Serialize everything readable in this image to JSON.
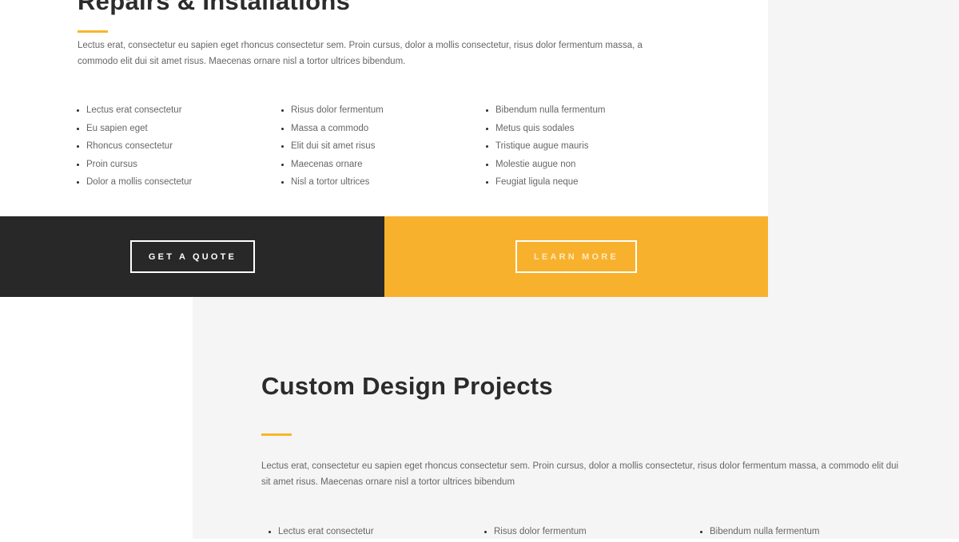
{
  "repairs": {
    "title": "Repairs & Installations",
    "paragraph": "Lectus erat, consectetur eu sapien eget rhoncus consectetur sem. Proin cursus, dolor a mollis consectetur, risus dolor fermentum massa, a commodo elit dui sit amet risus. Maecenas ornare nisl a tortor ultrices bibendum.",
    "list_columns": [
      [
        "Lectus erat consectetur",
        "Eu sapien eget",
        "Rhoncus consectetur",
        "Proin cursus",
        "Dolor a mollis consectetur"
      ],
      [
        "Risus dolor fermentum",
        "Massa a commodo",
        "Elit dui sit amet risus",
        "Maecenas ornare",
        "Nisl a tortor ultrices"
      ],
      [
        "Bibendum nulla fermentum",
        "Metus quis sodales",
        "Tristique augue mauris",
        "Molestie augue non",
        "Feugiat ligula neque"
      ]
    ]
  },
  "cta": {
    "quote_label": "GET A QUOTE",
    "learn_label": "LEARN MORE"
  },
  "custom": {
    "title": "Custom Design Projects",
    "paragraph": "Lectus erat, consectetur eu sapien eget rhoncus consectetur sem. Proin cursus, dolor a mollis consectetur, risus dolor fermentum massa, a commodo elit dui sit amet risus. Maecenas ornare nisl a tortor ultrices bibendum",
    "list_columns": [
      [
        "Lectus erat consectetur"
      ],
      [
        "Risus dolor fermentum"
      ],
      [
        "Bibendum nulla fermentum"
      ]
    ]
  },
  "colors": {
    "accent": "#f8b62d",
    "dark": "#282828",
    "light_gray": "#f5f5f5"
  }
}
